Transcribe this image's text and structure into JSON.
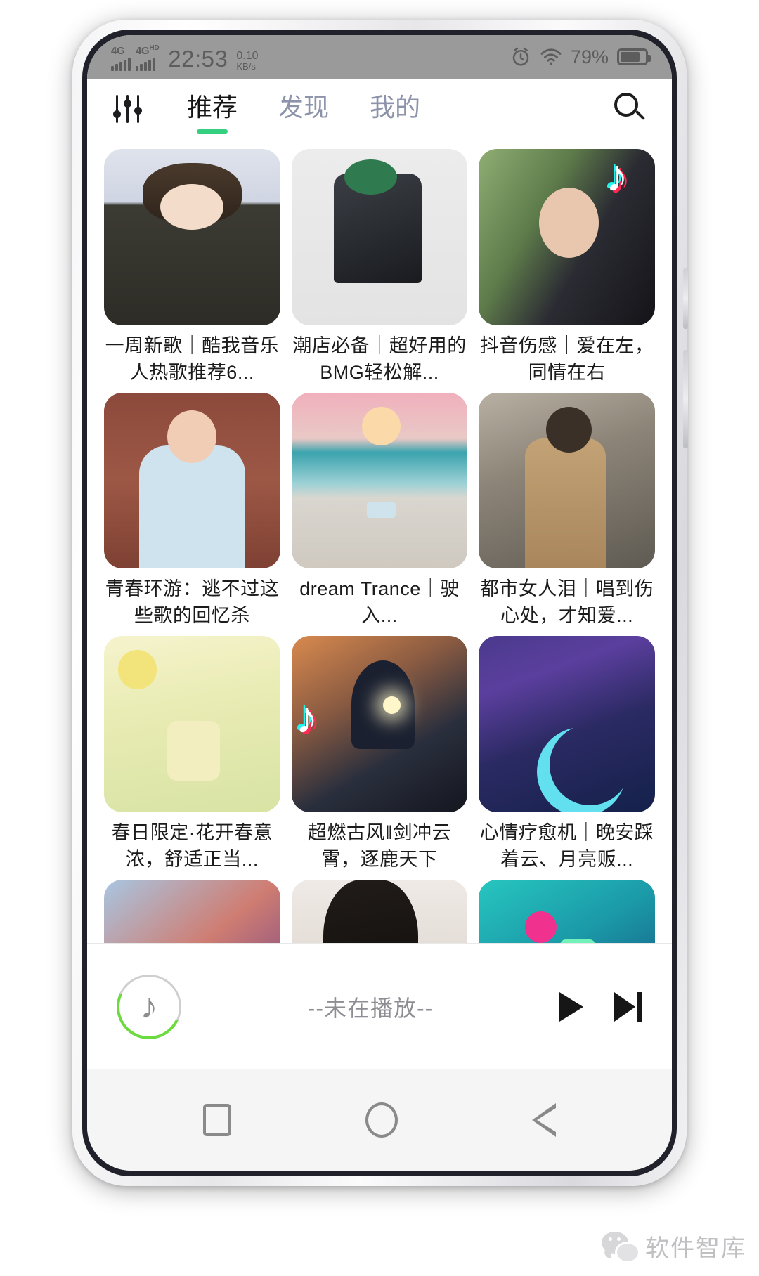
{
  "status_bar": {
    "network_1": "4G",
    "network_2": "4G",
    "network_2_sup": "HD",
    "time": "22:53",
    "net_speed_value": "0.10",
    "net_speed_unit": "KB/s",
    "alarm_icon": "alarm-icon",
    "wifi_icon": "wifi-icon",
    "battery_percent": "79%"
  },
  "top_nav": {
    "equalizer_icon": "equalizer-icon",
    "search_icon": "search-icon",
    "tabs": [
      {
        "label": "推荐",
        "active": true
      },
      {
        "label": "发现",
        "active": false
      },
      {
        "label": "我的",
        "active": false
      }
    ],
    "active_indicator_color": "#35d07f"
  },
  "grid": {
    "cards": [
      {
        "title": "一周新歌｜酷我音乐人热歌推荐6...",
        "art": "img-1",
        "badge": ""
      },
      {
        "title": "潮店必备｜超好用的BMG轻松解...",
        "art": "img-2",
        "badge": ""
      },
      {
        "title": "抖音伤感｜爱在左，同情在右",
        "art": "img-3",
        "badge": "tiktok-badge"
      },
      {
        "title": "青春环游：逃不过这些歌的回忆杀",
        "art": "img-4",
        "badge": ""
      },
      {
        "title": "dream Trance｜驶入...",
        "art": "img-5",
        "badge": ""
      },
      {
        "title": "都市女人泪｜唱到伤心处，才知爱...",
        "art": "img-6",
        "badge": ""
      },
      {
        "title": "春日限定·花开春意浓，舒适正当...",
        "art": "img-7",
        "badge": ""
      },
      {
        "title": "超燃古风‖剑冲云霄，逐鹿天下",
        "art": "img-8",
        "badge": "tiktok-badge"
      },
      {
        "title": "心情疗愈机｜晚安踩着云、月亮贩...",
        "art": "img-9",
        "badge": ""
      },
      {
        "title": "",
        "art": "img-10",
        "badge": ""
      },
      {
        "title": "",
        "art": "img-11",
        "badge": ""
      },
      {
        "title": "",
        "art": "img-12",
        "badge": ""
      }
    ]
  },
  "player": {
    "avatar_icon": "music-note-avatar-icon",
    "note_glyph": "♪",
    "title": "--未在播放--",
    "play_icon": "play-icon",
    "next_icon": "next-track-icon",
    "accent_color": "#6ddb3f"
  },
  "android_nav": {
    "recent_icon": "recent-apps-icon",
    "home_icon": "home-icon",
    "back_icon": "back-icon"
  },
  "watermark": {
    "icon": "wechat-icon",
    "text": "软件智库"
  }
}
